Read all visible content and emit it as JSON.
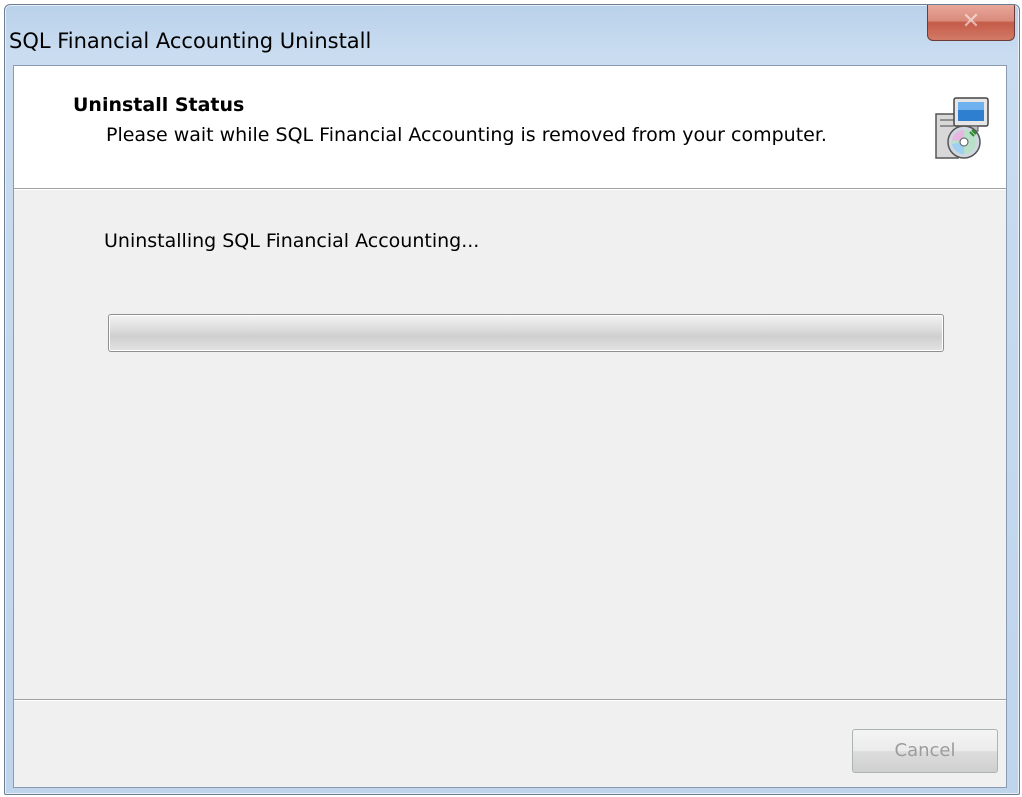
{
  "window": {
    "title": "SQL Financial Accounting Uninstall",
    "close_glyph": "✕"
  },
  "header": {
    "title": "Uninstall Status",
    "subtitle": "Please wait while SQL Financial Accounting is removed from your computer.",
    "icon": "setup-computer-cd-icon"
  },
  "main": {
    "status_text": "Uninstalling SQL Financial Accounting...",
    "progress_percent": 0
  },
  "footer": {
    "cancel_label": "Cancel",
    "cancel_enabled": false
  },
  "colors": {
    "titlebar": "#bfd5ec",
    "client_background": "#f0f0f0",
    "header_background": "#ffffff",
    "close_button": "#c45b48",
    "progress_fill": "#37c437",
    "disabled_text": "#9c9c9c"
  }
}
